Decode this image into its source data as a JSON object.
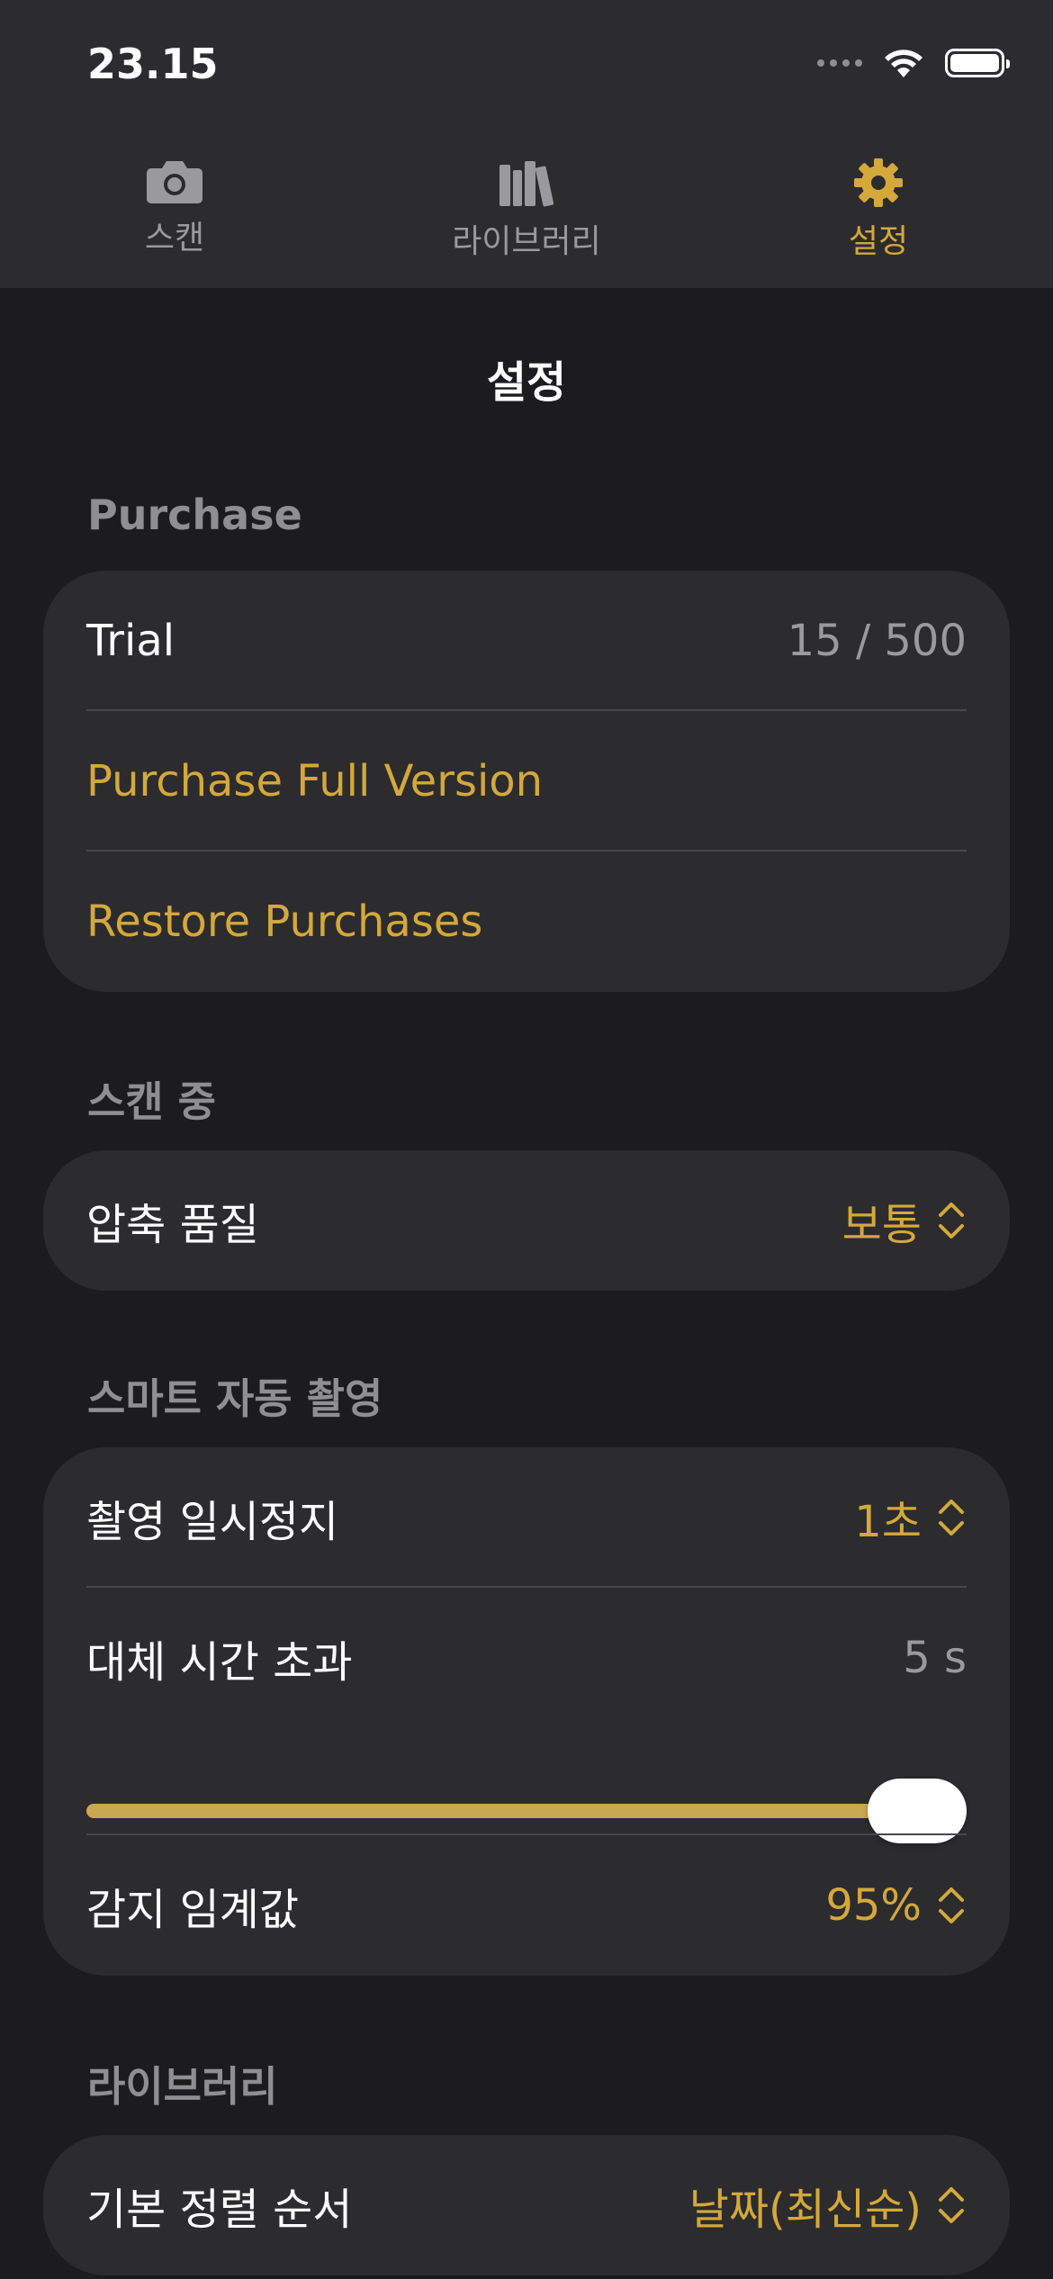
{
  "status_bar": {
    "time": "23.15"
  },
  "tabs": [
    {
      "label": "스캔",
      "icon": "camera-icon",
      "active": false
    },
    {
      "label": "라이브러리",
      "icon": "library-books-icon",
      "active": false
    },
    {
      "label": "설정",
      "icon": "gear-icon",
      "active": true
    }
  ],
  "colors": {
    "accent": "#d4a83a",
    "background": "#1c1c1e",
    "card": "#2c2c2e",
    "secondary_text": "#8e8e93"
  },
  "page_title": "설정",
  "sections": {
    "purchase": {
      "header": "Purchase",
      "trial_label": "Trial",
      "trial_value": "15 / 500",
      "purchase_full": "Purchase Full Version",
      "restore": "Restore Purchases"
    },
    "scanning": {
      "header": "스캔 중",
      "compression_label": "압축 품질",
      "compression_value": "보통"
    },
    "smart_capture": {
      "header": "스마트 자동 촬영",
      "pause_label": "촬영 일시정지",
      "pause_value": "1초",
      "fallback_label": "대체 시간 초과",
      "fallback_value": "5 s",
      "fallback_slider_level": 1.0,
      "threshold_label": "감지 임계값",
      "threshold_value": "95%"
    },
    "library": {
      "header": "라이브러리",
      "sort_label": "기본 정렬 순서",
      "sort_value": "날짜(최신순)"
    }
  }
}
